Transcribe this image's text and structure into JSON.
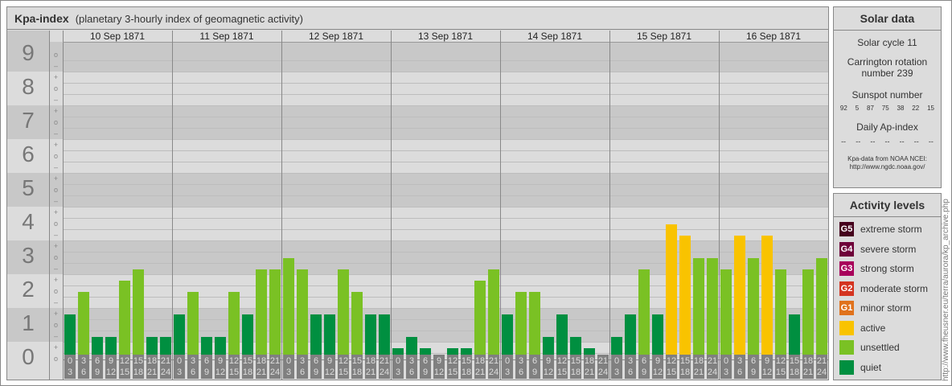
{
  "title": {
    "main": "Kpa-index",
    "sub": "(planetary 3-hourly index of geomagnetic activity)"
  },
  "days": [
    "10 Sep 1871",
    "11 Sep 1871",
    "12 Sep 1871",
    "13 Sep 1871",
    "14 Sep 1871",
    "15 Sep 1871",
    "16 Sep 1871"
  ],
  "kp_labels": [
    "9",
    "8",
    "7",
    "6",
    "5",
    "4",
    "3",
    "2",
    "1",
    "0"
  ],
  "hour_slots": [
    [
      "0",
      "3"
    ],
    [
      "3",
      "6"
    ],
    [
      "6",
      "9"
    ],
    [
      "9",
      "12"
    ],
    [
      "12",
      "15"
    ],
    [
      "15",
      "18"
    ],
    [
      "18",
      "21"
    ],
    [
      "21",
      "24"
    ]
  ],
  "chart_data": {
    "type": "bar",
    "title": "Kpa-index",
    "ylabel": "Kp",
    "ylim": [
      0,
      9
    ],
    "units": "thirds of Kp (e.g. 4 = 1+, 6 = 2o, 8 = 3-)",
    "series": [
      {
        "name": "10 Sep 1871",
        "values": [
          4,
          6,
          2,
          2,
          7,
          8,
          2,
          2
        ]
      },
      {
        "name": "11 Sep 1871",
        "values": [
          4,
          6,
          2,
          2,
          6,
          4,
          8,
          8
        ]
      },
      {
        "name": "12 Sep 1871",
        "values": [
          9,
          8,
          4,
          4,
          8,
          6,
          4,
          4
        ]
      },
      {
        "name": "13 Sep 1871",
        "values": [
          1,
          2,
          1,
          0,
          1,
          1,
          7,
          8
        ]
      },
      {
        "name": "14 Sep 1871",
        "values": [
          4,
          6,
          6,
          2,
          4,
          2,
          1,
          0
        ]
      },
      {
        "name": "15 Sep 1871",
        "values": [
          2,
          4,
          8,
          4,
          12,
          11,
          9,
          9
        ]
      },
      {
        "name": "16 Sep 1871",
        "values": [
          8,
          11,
          9,
          11,
          8,
          4,
          8,
          9
        ]
      }
    ]
  },
  "colors": {
    "quiet": "#008f40",
    "unsettled": "#7ac124",
    "active": "#f9c300",
    "g1": "#e0721c",
    "g2": "#d43420",
    "g3": "#a8005a",
    "g4": "#6e0038",
    "g5": "#45001c"
  },
  "solar": {
    "heading": "Solar data",
    "cycle": "Solar cycle 11",
    "carrington1": "Carrington rotation",
    "carrington2": "number 239",
    "sunspot_heading": "Sunspot number",
    "sunspots": [
      "92",
      "5",
      "87",
      "75",
      "38",
      "22",
      "15"
    ],
    "ap_heading": "Daily Ap-index",
    "ap": [
      "--",
      "--",
      "--",
      "--",
      "--",
      "--",
      "--"
    ],
    "source1": "Kpa-data from NOAA NCEI:",
    "source2": "http://www.ngdc.noaa.gov/"
  },
  "legend": {
    "heading": "Activity levels",
    "items": [
      {
        "badge": "G5",
        "label": "extreme storm",
        "color": "#45001c"
      },
      {
        "badge": "G4",
        "label": "severe storm",
        "color": "#6e0038"
      },
      {
        "badge": "G3",
        "label": "strong storm",
        "color": "#a8005a"
      },
      {
        "badge": "G2",
        "label": "moderate storm",
        "color": "#d43420"
      },
      {
        "badge": "G1",
        "label": "minor storm",
        "color": "#e0721c"
      },
      {
        "badge": "",
        "label": "active",
        "color": "#f9c300"
      },
      {
        "badge": "",
        "label": "unsettled",
        "color": "#7ac124"
      },
      {
        "badge": "",
        "label": "quiet",
        "color": "#008f40"
      }
    ]
  },
  "credit": "http://www.fheusner.eu/terra/aurora/kp_archive.php"
}
